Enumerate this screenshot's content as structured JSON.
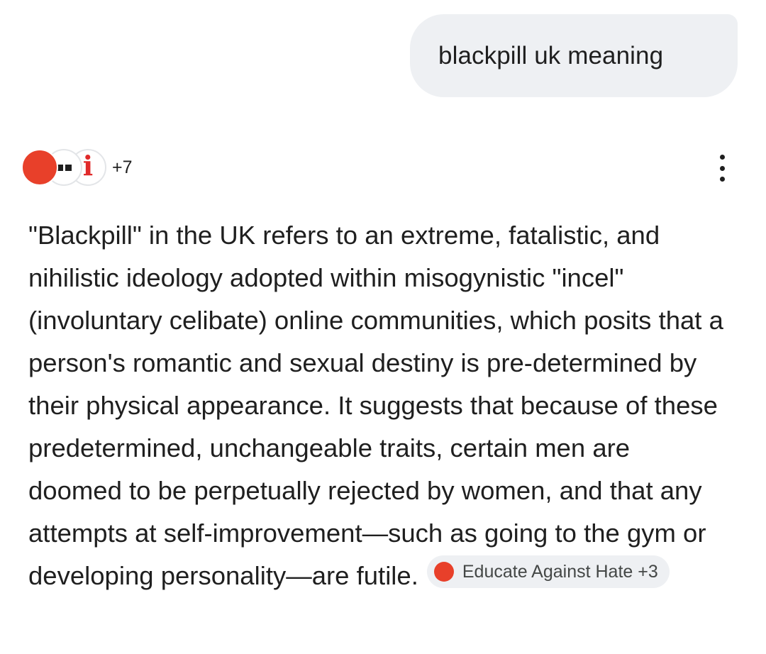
{
  "query": {
    "text": "blackpill uk meaning"
  },
  "sources": {
    "icons": [
      "red-circle-icon",
      "dots-icon",
      "info-i-icon"
    ],
    "more_count": "+7",
    "menu_icon": "more-vert-icon"
  },
  "answer": {
    "text": "\"Blackpill\" in the UK refers to an extreme, fatalistic, and nihilistic ideology adopted within misogynistic \"incel\" (involuntary celibate) online communities, which posits that a person's romantic and sexual destiny is pre-determined by their physical appearance. It suggests that because of these predetermined, unchangeable traits, certain men are doomed to be perpetually rejected by women, and that any attempts at self-improvement—such as going to the gym or developing personality—are futile.",
    "citation": {
      "label": "Educate Against Hate +3",
      "icon": "red-circle-icon"
    }
  },
  "colors": {
    "bubble_bg": "#eef0f3",
    "text": "#1f1f1f",
    "chip_text": "#444746",
    "red": "#e8402a"
  }
}
